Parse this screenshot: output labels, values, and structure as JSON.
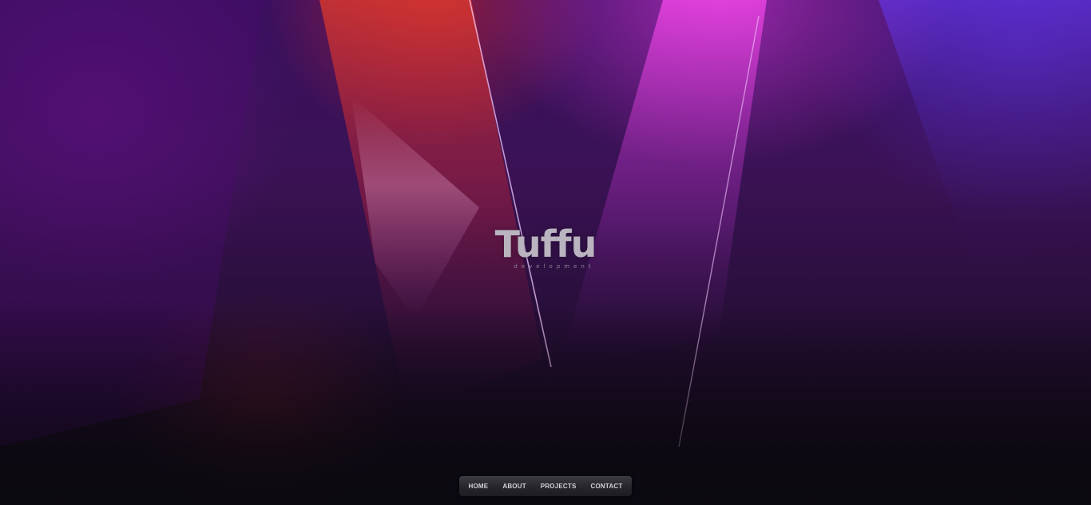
{
  "logo": {
    "title": "Tuffu",
    "subtitle": "development"
  },
  "nav": {
    "items": [
      {
        "label": "HOME"
      },
      {
        "label": "ABOUT"
      },
      {
        "label": "PROJECTS"
      },
      {
        "label": "CONTACT"
      }
    ]
  },
  "colors": {
    "logo_text": "#b9b4bf",
    "nav_text": "#d2d2d8",
    "background_top": "#3a1060",
    "background_bottom": "#0e0b14"
  }
}
